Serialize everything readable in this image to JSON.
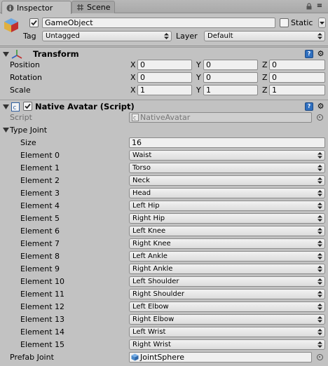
{
  "tabs": [
    {
      "label": "Inspector",
      "icon": "info-icon",
      "active": true
    },
    {
      "label": "Scene",
      "icon": "grid-icon",
      "active": false
    }
  ],
  "header": {
    "object_name": "GameObject",
    "static_label": "Static",
    "tag_label": "Tag",
    "tag_value": "Untagged",
    "layer_label": "Layer",
    "layer_value": "Default"
  },
  "transform": {
    "title": "Transform",
    "rows": [
      {
        "label": "Position",
        "x": "0",
        "y": "0",
        "z": "0"
      },
      {
        "label": "Rotation",
        "x": "0",
        "y": "0",
        "z": "0"
      },
      {
        "label": "Scale",
        "x": "1",
        "y": "1",
        "z": "1"
      }
    ],
    "axis_x": "X",
    "axis_y": "Y",
    "axis_z": "Z"
  },
  "script_component": {
    "title": "Native Avatar (Script)",
    "script_label": "Script",
    "script_value": "NativeAvatar",
    "type_joint_label": "Type Joint",
    "size_label": "Size",
    "size_value": "16",
    "elements": [
      {
        "label": "Element 0",
        "value": "Waist"
      },
      {
        "label": "Element 1",
        "value": "Torso"
      },
      {
        "label": "Element 2",
        "value": "Neck"
      },
      {
        "label": "Element 3",
        "value": "Head"
      },
      {
        "label": "Element 4",
        "value": "Left Hip"
      },
      {
        "label": "Element 5",
        "value": "Right Hip"
      },
      {
        "label": "Element 6",
        "value": "Left Knee"
      },
      {
        "label": "Element 7",
        "value": "Right Knee"
      },
      {
        "label": "Element 8",
        "value": "Left Ankle"
      },
      {
        "label": "Element 9",
        "value": "Right Ankle"
      },
      {
        "label": "Element 10",
        "value": "Left Shoulder"
      },
      {
        "label": "Element 11",
        "value": "Right Shoulder"
      },
      {
        "label": "Element 12",
        "value": "Left Elbow"
      },
      {
        "label": "Element 13",
        "value": "Right Elbow"
      },
      {
        "label": "Element 14",
        "value": "Left Wrist"
      },
      {
        "label": "Element 15",
        "value": "Right Wrist"
      }
    ],
    "prefab_label": "Prefab Joint",
    "prefab_value": "JointSphere"
  },
  "colors": {
    "background": "#c2c2c2",
    "help_blue": "#2f6fbf"
  }
}
